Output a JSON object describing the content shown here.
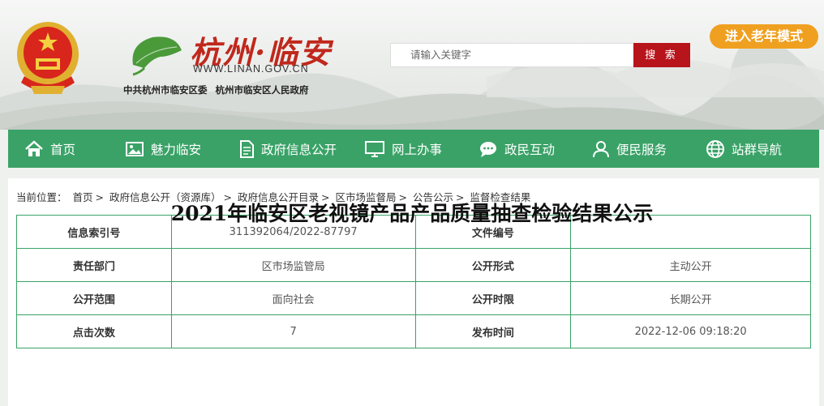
{
  "header": {
    "logo_title": "杭州·临安",
    "logo_url": "WWW.LINAN.GOV.CN",
    "sub_org1": "中共杭州市临安区委",
    "sub_org2": "杭州市临安区人民政府",
    "search_placeholder": "请输入关键字",
    "search_button": "搜 索",
    "elder_mode": "进入老年模式"
  },
  "nav": [
    {
      "label": "首页",
      "icon": "home-icon"
    },
    {
      "label": "魅力临安",
      "icon": "picture-icon"
    },
    {
      "label": "政府信息公开",
      "icon": "document-icon"
    },
    {
      "label": "网上办事",
      "icon": "monitor-icon"
    },
    {
      "label": "政民互动",
      "icon": "chat-icon"
    },
    {
      "label": "便民服务",
      "icon": "user-icon"
    },
    {
      "label": "站群导航",
      "icon": "globe-icon"
    }
  ],
  "breadcrumb": {
    "prefix": "当前位置：",
    "items": [
      "首页",
      "政府信息公开（资源库）",
      "政府信息公开目录",
      "区市场监督局",
      "公告公示",
      "监督检查结果"
    ],
    "separator": ">"
  },
  "info_table": [
    [
      "信息索引号",
      "311392064/2022-87797",
      "文件编号",
      ""
    ],
    [
      "责任部门",
      "区市场监管局",
      "公开形式",
      "主动公开"
    ],
    [
      "公开范围",
      "面向社会",
      "公开时限",
      "长期公开"
    ],
    [
      "点击次数",
      "7",
      "发布时间",
      "2022-12-06 09:18:20"
    ]
  ],
  "doc_title": "2021年临安区老视镜产品产品质量抽查检验结果公示",
  "colors": {
    "nav_green": "#3aa267",
    "search_red": "#b8141c",
    "elder_orange": "#f0a020",
    "logo_red": "#c0281c"
  }
}
